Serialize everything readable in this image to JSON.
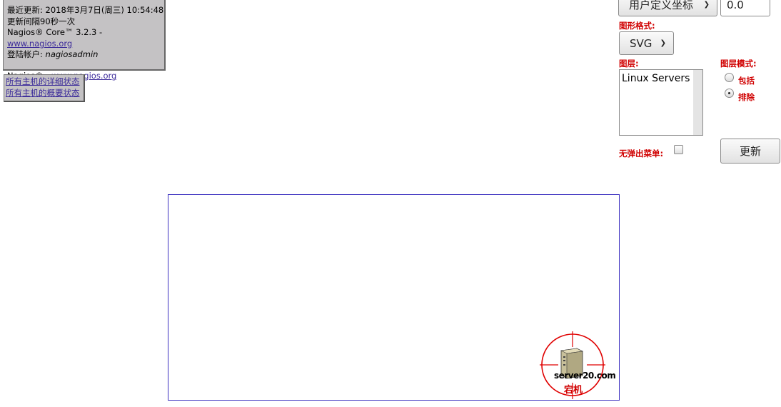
{
  "info": {
    "last_updated": "最近更新: 2018年3月7日(周三) 10:54:48",
    "refresh": "更新间隔90秒一次",
    "core_prefix": "Nagios® Core™ 3.2.3 - ",
    "core_link": "www.nagios.org",
    "login_prefix": "登陆帐户: ",
    "login_user": "nagiosadmin",
    "nagios_prefix": "Nagios® - ",
    "nagios_link": "www.nagios.org"
  },
  "links": {
    "detail": "所有主机的详细状态",
    "summary": "所有主机的概要状态"
  },
  "controls": {
    "layout_select": "用户定义坐标",
    "scale_value": "0.0",
    "image_format_label": "图形格式:",
    "image_format": "SVG",
    "layers_label": "图层:",
    "layers": [
      "Linux Servers"
    ],
    "layer_mode_label": "图层模式:",
    "mode_include": "包括",
    "mode_exclude": "排除",
    "no_popups_label": "无弹出菜单:",
    "update_button": "更新"
  },
  "map": {
    "host_name": "server20.com",
    "host_state": "宕机"
  },
  "colors": {
    "label_red": "#d00000",
    "link": "#3b2a9a",
    "map_border": "#3b2fbf"
  }
}
